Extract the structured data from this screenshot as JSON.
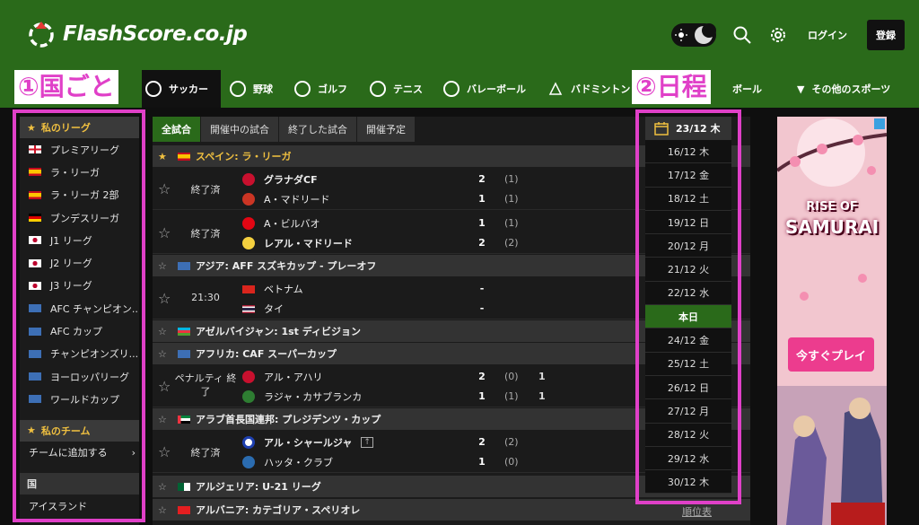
{
  "header": {
    "logo_text": "FlashScore.co.jp",
    "login_label": "ログイン",
    "register_label": "登録"
  },
  "sports": [
    {
      "label": "サッカー",
      "icon": "soccer-ball-icon",
      "active": true
    },
    {
      "label": "野球",
      "icon": "baseball-icon"
    },
    {
      "label": "ゴルフ",
      "icon": "golf-ball-icon"
    },
    {
      "label": "テニス",
      "icon": "tennis-ball-icon"
    },
    {
      "label": "バレーボール",
      "icon": "volleyball-icon"
    },
    {
      "label": "バドミントン",
      "icon": "shuttlecock-icon"
    },
    {
      "label": "ボール",
      "icon": ""
    },
    {
      "label": "その他のスポーツ",
      "icon": "chevron-down-icon"
    }
  ],
  "annotations": {
    "left": "①国ごと",
    "right": "②日程"
  },
  "sidebar": {
    "my_leagues_title": "私のリーグ",
    "leagues": [
      {
        "label": "プレミアリーグ",
        "flag": "england"
      },
      {
        "label": "ラ・リーガ",
        "flag": "spain"
      },
      {
        "label": "ラ・リーガ 2部",
        "flag": "spain"
      },
      {
        "label": "ブンデスリーガ",
        "flag": "germany"
      },
      {
        "label": "J1 リーグ",
        "flag": "japan"
      },
      {
        "label": "J2 リーグ",
        "flag": "japan"
      },
      {
        "label": "J3 リーグ",
        "flag": "japan"
      },
      {
        "label": "AFC チャンピオン...",
        "flag": "world"
      },
      {
        "label": "AFC カップ",
        "flag": "world"
      },
      {
        "label": "チャンピオンズリ...",
        "flag": "world"
      },
      {
        "label": "ヨーロッパリーグ",
        "flag": "world"
      },
      {
        "label": "ワールドカップ",
        "flag": "world"
      }
    ],
    "my_teams_title": "私のチーム",
    "add_team_label": "チームに追加する",
    "countries_title": "国",
    "first_country": "アイスランド"
  },
  "tabs": [
    "全試合",
    "開催中の試合",
    "終了した試合",
    "開催予定"
  ],
  "leagues": [
    {
      "title": "スペイン: ラ・リーガ",
      "flag": "spain",
      "starred": true
    },
    {
      "title": "アジア: AFF スズキカップ - プレーオフ",
      "flag": "world"
    },
    {
      "title": "アゼルバイジャン: 1st ディビジョン",
      "flag": "azerbaijan"
    },
    {
      "title": "アフリカ: CAF スーパーカップ",
      "flag": "world"
    },
    {
      "title": "アラブ首長国連邦: プレジデンツ・カップ",
      "flag": "uae"
    },
    {
      "title": "アルジェリア: U-21 リーグ",
      "flag": "algeria"
    },
    {
      "title": "アルバニア: カテゴリア・スペリオレ",
      "flag": "albania"
    }
  ],
  "matches": [
    {
      "status": "終了済",
      "home": "グラナダCF",
      "away": "A・マドリード",
      "hs": "2",
      "as": "1",
      "hp": "(1)",
      "ap": "(1)",
      "home_win": true
    },
    {
      "status": "終了済",
      "home": "A・ビルバオ",
      "away": "レアル・マドリード",
      "hs": "1",
      "as": "2",
      "hp": "(1)",
      "ap": "(2)",
      "away_win": true
    },
    {
      "status": "21:30",
      "home": "ベトナム",
      "away": "タイ",
      "hs": "-",
      "as": "-",
      "hp": "",
      "ap": ""
    },
    {
      "status": "ペナルティ 終了",
      "home": "アル・アハリ",
      "away": "ラジャ・カサブランカ",
      "hs": "2",
      "as": "1",
      "hp": "(0)",
      "ap": "(1)",
      "he": "1",
      "ae": "1"
    },
    {
      "status": "終了済",
      "home": "アル・シャールジャ",
      "away": "ハッタ・クラブ",
      "hs": "2",
      "as": "1",
      "hp": "(2)",
      "ap": "(0)",
      "home_win": true
    }
  ],
  "calendar": {
    "selected": "23/12 木",
    "dates": [
      "16/12 木",
      "17/12 金",
      "18/12 土",
      "19/12 日",
      "20/12 月",
      "21/12 火",
      "22/12 水",
      "本日",
      "24/12 金",
      "25/12 土",
      "26/12 日",
      "27/12 月",
      "28/12 火",
      "29/12 水",
      "30/12 木"
    ],
    "today_index": 7
  },
  "ad": {
    "title_line1": "RISE OF",
    "title_line2": "SAMURAI",
    "button": "今すぐプレイ"
  },
  "rank_link": "順位表",
  "colors": {
    "header_green": "#2a6a1a",
    "annotation_pink": "#e040c8",
    "star_gold": "#f0c040"
  }
}
